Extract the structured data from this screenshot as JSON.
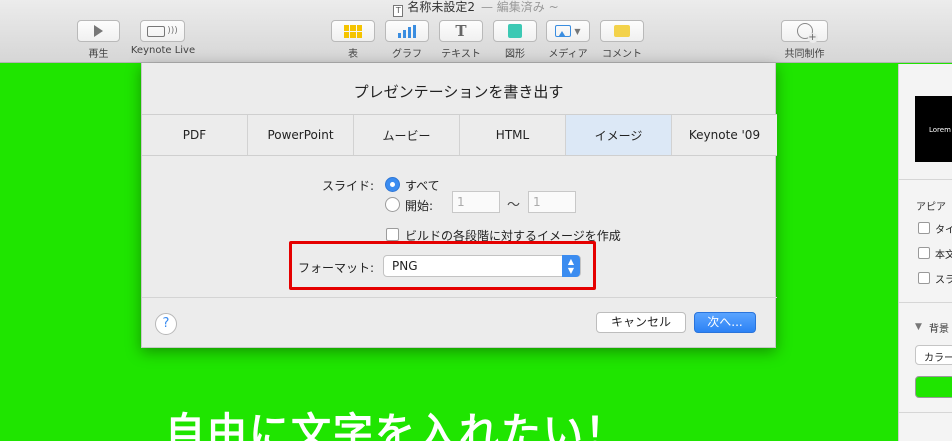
{
  "window": {
    "doc_title": "名称未設定2",
    "status": "— 編集済み ~"
  },
  "toolbar": {
    "play_label": "再生",
    "keynote_live_label": "Keynote Live",
    "table_label": "表",
    "chart_label": "グラフ",
    "text_label": "テキスト",
    "shape_label": "図形",
    "media_label": "メディア",
    "comment_label": "コメント",
    "collaborate_label": "共同制作"
  },
  "slide": {
    "text": "自由に文字を入れたい！"
  },
  "inspector": {
    "thumb_text": "Lorem I",
    "appearance_label": "アピア",
    "checks": [
      "タイ",
      "本文",
      "スラ"
    ],
    "background_label": "背景",
    "fill_popup": "カラー",
    "fill_color": "#1fe500"
  },
  "dialog": {
    "title": "プレゼンテーションを書き出す",
    "tabs": [
      "PDF",
      "PowerPoint",
      "ムービー",
      "HTML",
      "イメージ",
      "Keynote '09"
    ],
    "selected_tab": "イメージ",
    "slides_label": "スライド:",
    "all_label": "すべて",
    "start_label": "開始:",
    "start_from": "1",
    "start_to": "1",
    "range_sep": "〜",
    "build_label": "ビルドの各段階に対するイメージを作成",
    "format_label": "フォーマット:",
    "format_value": "PNG",
    "help": "?",
    "cancel_label": "キャンセル",
    "next_label": "次へ..."
  },
  "colors": {
    "accent": "#3b8cf0",
    "highlight": "#e50000",
    "slide_bg": "#1fe500"
  }
}
